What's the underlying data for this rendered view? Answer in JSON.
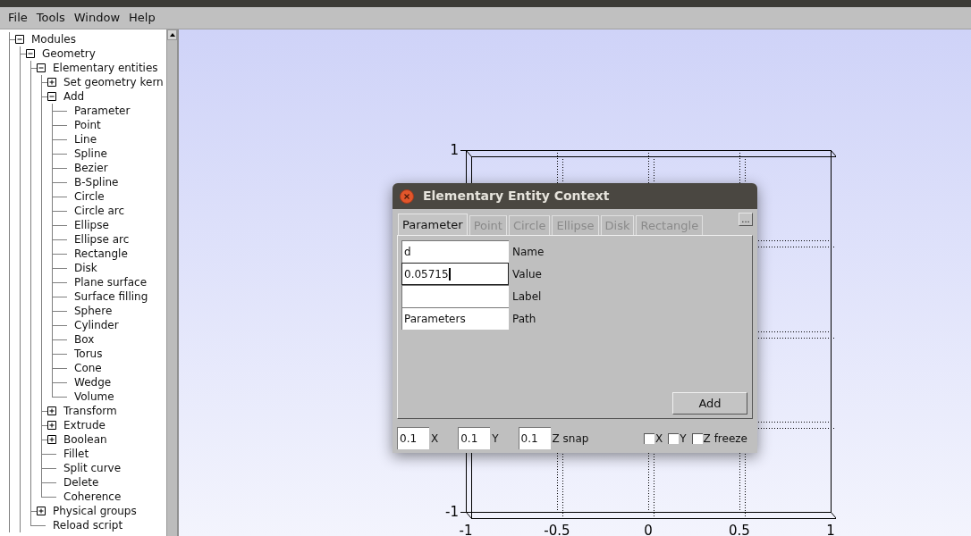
{
  "menu": [
    "File",
    "Tools",
    "Window",
    "Help"
  ],
  "tree": [
    {
      "label": "Modules",
      "expanded": true,
      "children": [
        {
          "label": "Geometry",
          "expanded": true,
          "children": [
            {
              "label": "Elementary entities",
              "expanded": true,
              "children": [
                {
                  "label": "Set geometry kern",
                  "expanded": false
                },
                {
                  "label": "Add",
                  "expanded": true,
                  "children": [
                    {
                      "label": "Parameter"
                    },
                    {
                      "label": "Point"
                    },
                    {
                      "label": "Line"
                    },
                    {
                      "label": "Spline"
                    },
                    {
                      "label": "Bezier"
                    },
                    {
                      "label": "B-Spline"
                    },
                    {
                      "label": "Circle"
                    },
                    {
                      "label": "Circle arc"
                    },
                    {
                      "label": "Ellipse"
                    },
                    {
                      "label": "Ellipse arc"
                    },
                    {
                      "label": "Rectangle"
                    },
                    {
                      "label": "Disk"
                    },
                    {
                      "label": "Plane surface"
                    },
                    {
                      "label": "Surface filling"
                    },
                    {
                      "label": "Sphere"
                    },
                    {
                      "label": "Cylinder"
                    },
                    {
                      "label": "Box"
                    },
                    {
                      "label": "Torus"
                    },
                    {
                      "label": "Cone"
                    },
                    {
                      "label": "Wedge"
                    },
                    {
                      "label": "Volume"
                    }
                  ]
                },
                {
                  "label": "Transform",
                  "expanded": false
                },
                {
                  "label": "Extrude",
                  "expanded": false
                },
                {
                  "label": "Boolean",
                  "expanded": false
                },
                {
                  "label": "Fillet"
                },
                {
                  "label": "Split curve"
                },
                {
                  "label": "Delete"
                },
                {
                  "label": "Coherence"
                }
              ]
            },
            {
              "label": "Physical groups",
              "expanded": false
            },
            {
              "label": "Reload script"
            }
          ]
        }
      ]
    }
  ],
  "viewport": {
    "y_tick_labels": [
      "1",
      "-1"
    ],
    "x_tick_labels": [
      "-1",
      "-0.5",
      "0",
      "0.5",
      "1"
    ]
  },
  "dialog": {
    "title": "Elementary Entity Context",
    "tabs": [
      {
        "label": "Parameter",
        "selected": true,
        "disabled": false
      },
      {
        "label": "Point",
        "selected": false,
        "disabled": true
      },
      {
        "label": "Circle",
        "selected": false,
        "disabled": true
      },
      {
        "label": "Ellipse",
        "selected": false,
        "disabled": true
      },
      {
        "label": "Disk",
        "selected": false,
        "disabled": true
      },
      {
        "label": "Rectangle",
        "selected": false,
        "disabled": true
      }
    ],
    "more_button": "...",
    "fields": [
      {
        "label": "Name",
        "value": "d",
        "focused": false
      },
      {
        "label": "Value",
        "value": "0.05715",
        "focused": true
      },
      {
        "label": "Label",
        "focused": false
      },
      {
        "label": "Path",
        "value": "Parameters",
        "focused": false
      }
    ],
    "add_button": "Add",
    "snap": [
      {
        "value": "0.1",
        "label": "X"
      },
      {
        "value": "0.1",
        "label": "Y"
      },
      {
        "value": "0.1",
        "label": "Z snap"
      }
    ],
    "checkboxes": [
      {
        "label": "X",
        "checked": false
      },
      {
        "label": "Y",
        "checked": false
      },
      {
        "label": "Z freeze",
        "checked": false
      }
    ]
  }
}
